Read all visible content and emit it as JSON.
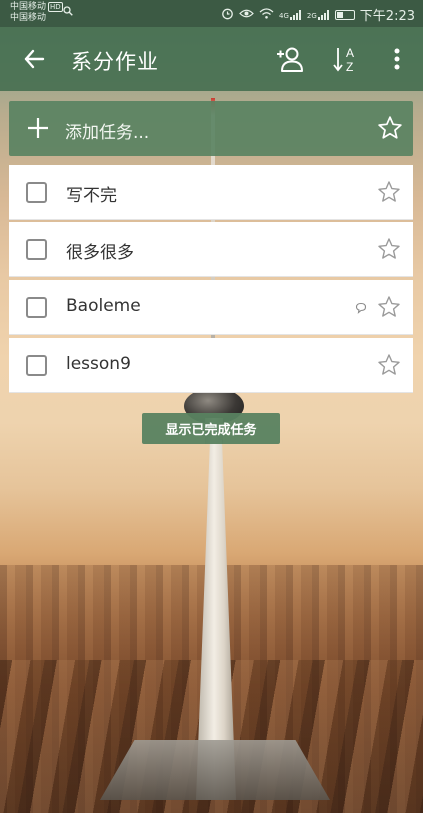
{
  "status_bar": {
    "carrier_primary": "中国移动",
    "carrier_badge": "HD",
    "carrier_secondary": "中国移动",
    "signal_1": "4G",
    "signal_2": "2G",
    "time": "下午2:23"
  },
  "app_bar": {
    "title": "系分作业",
    "actions": [
      "add-member-icon",
      "sort-az-icon",
      "more-vert-icon"
    ]
  },
  "add_task": {
    "placeholder": "添加任务..."
  },
  "tasks": [
    {
      "label": "写不完",
      "completed": false,
      "starred": false,
      "has_note": false
    },
    {
      "label": "很多很多",
      "completed": false,
      "starred": false,
      "has_note": false
    },
    {
      "label": "Baoleme",
      "completed": false,
      "starred": false,
      "has_note": true
    },
    {
      "label": "lesson9",
      "completed": false,
      "starred": false,
      "has_note": false
    }
  ],
  "show_completed_label": "显示已完成任务",
  "colors": {
    "status_bar": "#3c5a44",
    "app_bar": "#487052",
    "accent_green": "#58825f",
    "task_bg": "#ffffff",
    "text": "#333333"
  }
}
